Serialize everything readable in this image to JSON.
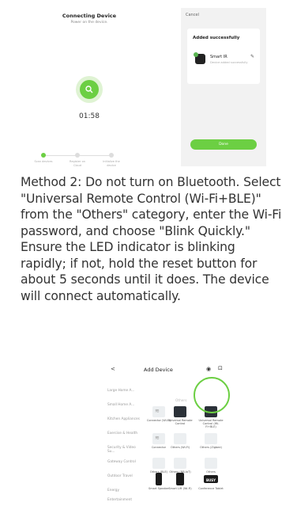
{
  "left_phone": {
    "title": "Connecting Device",
    "subtitle": "Power on the device.",
    "timer": "01:58",
    "steps": [
      "Scan devices",
      "Register on Cloud",
      "Initialize the device"
    ]
  },
  "right_phone": {
    "cancel": "Cancel",
    "card_title": "Added successfully",
    "device_name": "Smart IR",
    "device_desc": "Device added successfully",
    "done": "Done"
  },
  "paragraph": "Method 2: Do not turn on Bluetooth. Select \"Universal Remote Control (Wi-Fi+BLE)\" from the \"Others\" category, enter the Wi-Fi password, and choose \"Blink Quickly.\" Ensure the LED indicator is blinking rapidly; if not, hold the reset button for about 5 seconds until it does. The device will connect automatically.",
  "add_device": {
    "back": "<",
    "title": "Add Device",
    "categories": [
      "Large Home A...",
      "Small Home A...",
      "Kitchen Appliances",
      "Exercise & Health",
      "Security & Video Su...",
      "Gateway Control",
      "Outdoor Travel",
      "Energy",
      "Entertainment"
    ],
    "section": "Others",
    "tiles": [
      [
        "Connector (Wi-Fi)",
        "Universal Remote Control",
        "Universal Remote Control (Wi-Fi+BLE)"
      ],
      [
        "Connector",
        "Others (Wi-Fi)",
        "Others (Zigbee)"
      ],
      [
        "Others (BLE)",
        "Others (NB-IoT)",
        "Others"
      ],
      [
        "Smart Speaker",
        "Smart Lift (Wi-Fi)",
        "Conference Tablet"
      ]
    ],
    "busy_label": "BUSY"
  },
  "colors": {
    "accent": "#6ccf43"
  }
}
